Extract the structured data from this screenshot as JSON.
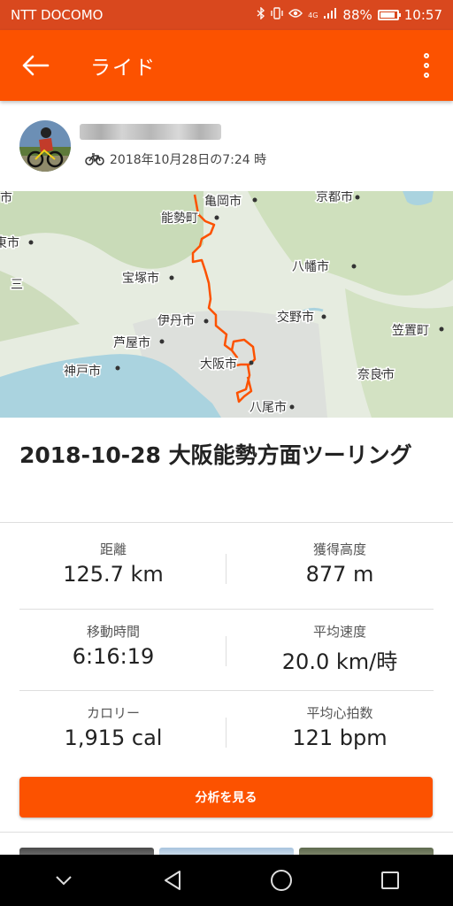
{
  "status_bar": {
    "carrier": "NTT DOCOMO",
    "network": "4G",
    "battery": "88%",
    "battery_level": 0.88,
    "time": "10:57",
    "icons": [
      "bluetooth-icon",
      "vibrate-icon",
      "eye-icon",
      "signal-icon",
      "battery-icon"
    ]
  },
  "app_bar": {
    "title": "ライド",
    "back_icon": "arrow-left-icon",
    "more_icon": "more-vertical-icon"
  },
  "athlete": {
    "date_text": "2018年10月28日の7:24 時",
    "activity_icon": "bike-icon"
  },
  "map": {
    "labels": {
      "kameoka": "亀岡市",
      "kyoto": "京都市",
      "nose": "能勢町",
      "higashi": "東市",
      "a": "三",
      "takarazuka": "宝塚市",
      "itami": "伊丹市",
      "katano": "交野市",
      "ashiya": "芦屋市",
      "kasagi": "笠置町",
      "kobe": "神戸市",
      "osaka": "大阪市",
      "nara": "奈良市",
      "yao": "八尾市",
      "yawata": "八幡市",
      "left_top": "市"
    },
    "colors": {
      "route": "#fc5200",
      "water": "#aad3df",
      "land": "#e8eee0"
    }
  },
  "ride": {
    "title": "2018-10-28 大阪能勢方面ツーリング"
  },
  "stats": [
    {
      "label": "距離",
      "value": "125.7 km"
    },
    {
      "label": "獲得高度",
      "value": "877 m"
    },
    {
      "label": "移動時間",
      "value": "6:16:19"
    },
    {
      "label": "平均速度",
      "value": "20.0 km/時"
    },
    {
      "label": "カロリー",
      "value": "1,915 cal"
    },
    {
      "label": "平均心拍数",
      "value": "121 bpm"
    }
  ],
  "actions": {
    "analyze_label": "分析を見る"
  },
  "nav": {
    "icons": [
      "chevron-down-icon",
      "back-triangle-icon",
      "home-circle-icon",
      "recents-square-icon"
    ]
  },
  "colors": {
    "accent": "#fc5200",
    "status_bar": "#d9481e"
  }
}
